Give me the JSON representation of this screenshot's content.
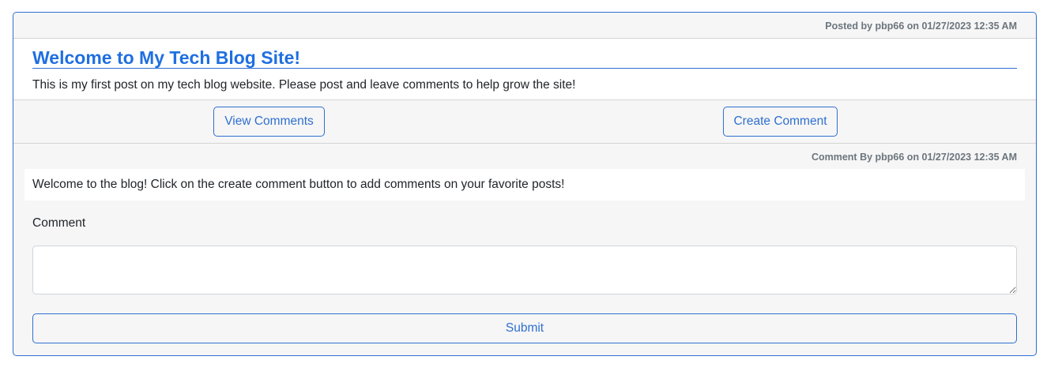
{
  "post": {
    "header": "Posted by pbp66 on 01/27/2023 12:35 AM",
    "title": "Welcome to My Tech Blog Site!",
    "body": "This is my first post on my tech blog website. Please post and leave comments to help grow the site!"
  },
  "actions": {
    "view_comments_label": "View Comments",
    "create_comment_label": "Create Comment"
  },
  "comments": [
    {
      "meta": "Comment By pbp66 on 01/27/2023 12:35 AM",
      "text": "Welcome to the blog! Click on the create comment button to add comments on your favorite posts!"
    }
  ],
  "comment_form": {
    "label": "Comment",
    "value": "",
    "submit_label": "Submit"
  },
  "colors": {
    "accent": "#2f6fd0",
    "title": "#1f6fe0",
    "muted_text": "#6c757d",
    "card_background": "#f6f6f6"
  }
}
